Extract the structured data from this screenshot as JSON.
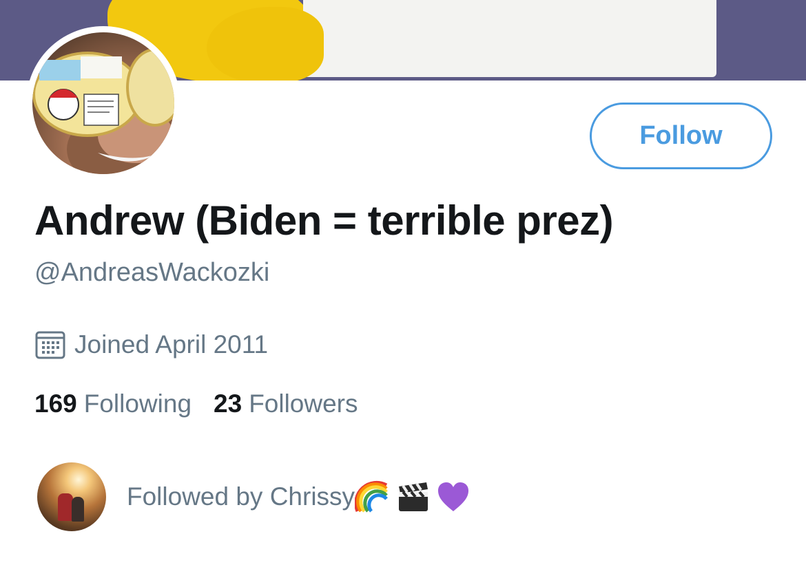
{
  "profile": {
    "display_name": "Andrew (Biden = terrible prez)",
    "handle": "@AndreasWackozki",
    "joined": "Joined April 2011",
    "following_count": "169",
    "following_label": "Following",
    "followers_count": "23",
    "followers_label": "Followers"
  },
  "actions": {
    "follow_label": "Follow"
  },
  "followed_by": {
    "text": "Followed by Chrissy",
    "emojis": [
      "rainbow-icon",
      "clapper-board-icon",
      "purple-heart-icon"
    ]
  },
  "icons": {
    "joined": "calendar-icon"
  },
  "colors": {
    "accent": "#4a9be0",
    "primary_text": "#14171a",
    "secondary_text": "#657786",
    "banner": "#5c5a86"
  }
}
